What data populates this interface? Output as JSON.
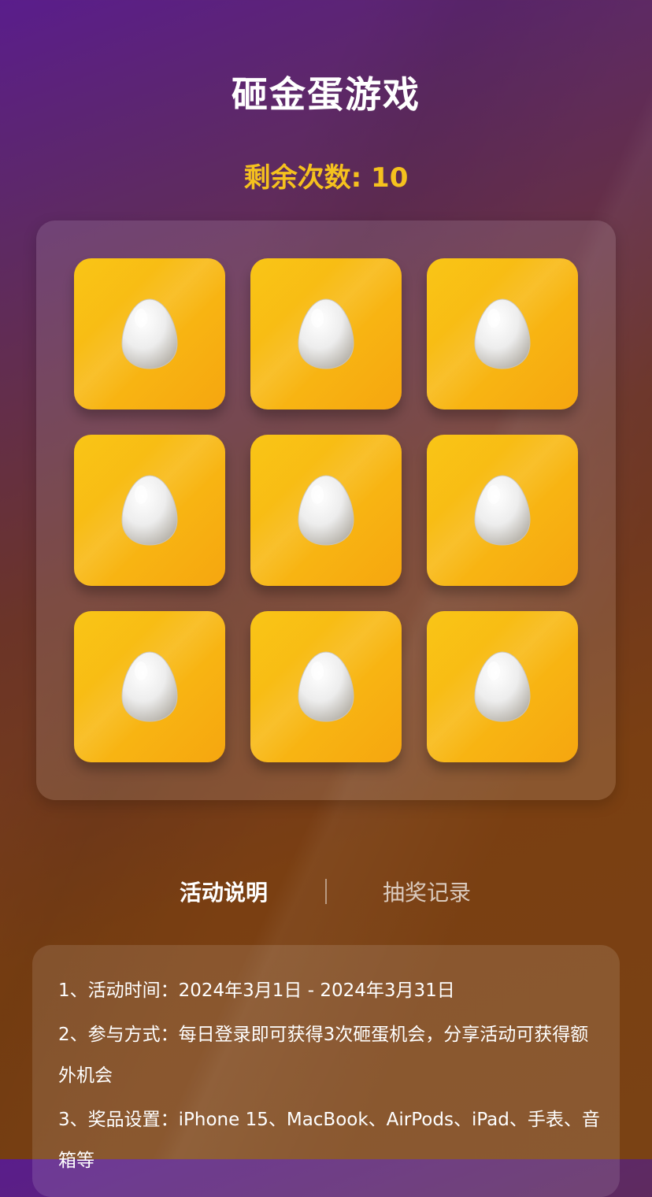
{
  "game": {
    "title": "砸金蛋游戏",
    "remaining_label": "剩余次数: ",
    "remaining_count": "10",
    "eggs": [
      {
        "id": 1,
        "state": "intact"
      },
      {
        "id": 2,
        "state": "intact"
      },
      {
        "id": 3,
        "state": "intact"
      },
      {
        "id": 4,
        "state": "intact"
      },
      {
        "id": 5,
        "state": "intact"
      },
      {
        "id": 6,
        "state": "intact"
      },
      {
        "id": 7,
        "state": "intact"
      },
      {
        "id": 8,
        "state": "intact"
      },
      {
        "id": 9,
        "state": "intact"
      }
    ]
  },
  "tabs": [
    {
      "label": "活动说明",
      "active": true
    },
    {
      "label": "抽奖记录",
      "active": false
    }
  ],
  "rules": [
    "1、活动时间：2024年3月1日 - 2024年3月31日",
    "2、参与方式：每日登录即可获得3次砸蛋机会，分享活动可获得额外机会",
    "3、奖品设置：iPhone 15、MacBook、AirPods、iPad、手表、音箱等"
  ],
  "colors": {
    "accent": "#f5c11e",
    "egg_tile": "#f8b613",
    "egg": "#ececec"
  },
  "icons": {
    "egg": "egg-icon"
  }
}
